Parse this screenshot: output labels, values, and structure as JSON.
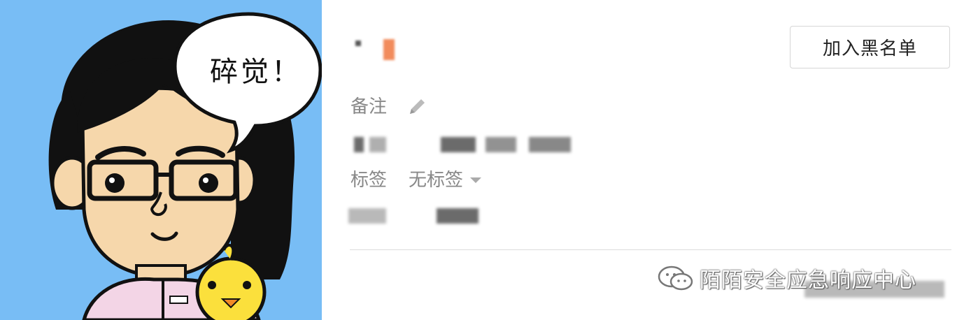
{
  "avatar": {
    "speech_bubble_text": "碎觉！",
    "background_color": "#78bdf5"
  },
  "profile": {
    "blacklist_button_label": "加入黑名单",
    "remark_label": "备注",
    "tags_label": "标签",
    "tags_value": "无标签",
    "edit_icon": "pencil-icon",
    "dropdown_icon": "caret-down-icon"
  },
  "watermark": {
    "text": "陌陌安全应急响应中心",
    "icon": "wechat-icon"
  }
}
